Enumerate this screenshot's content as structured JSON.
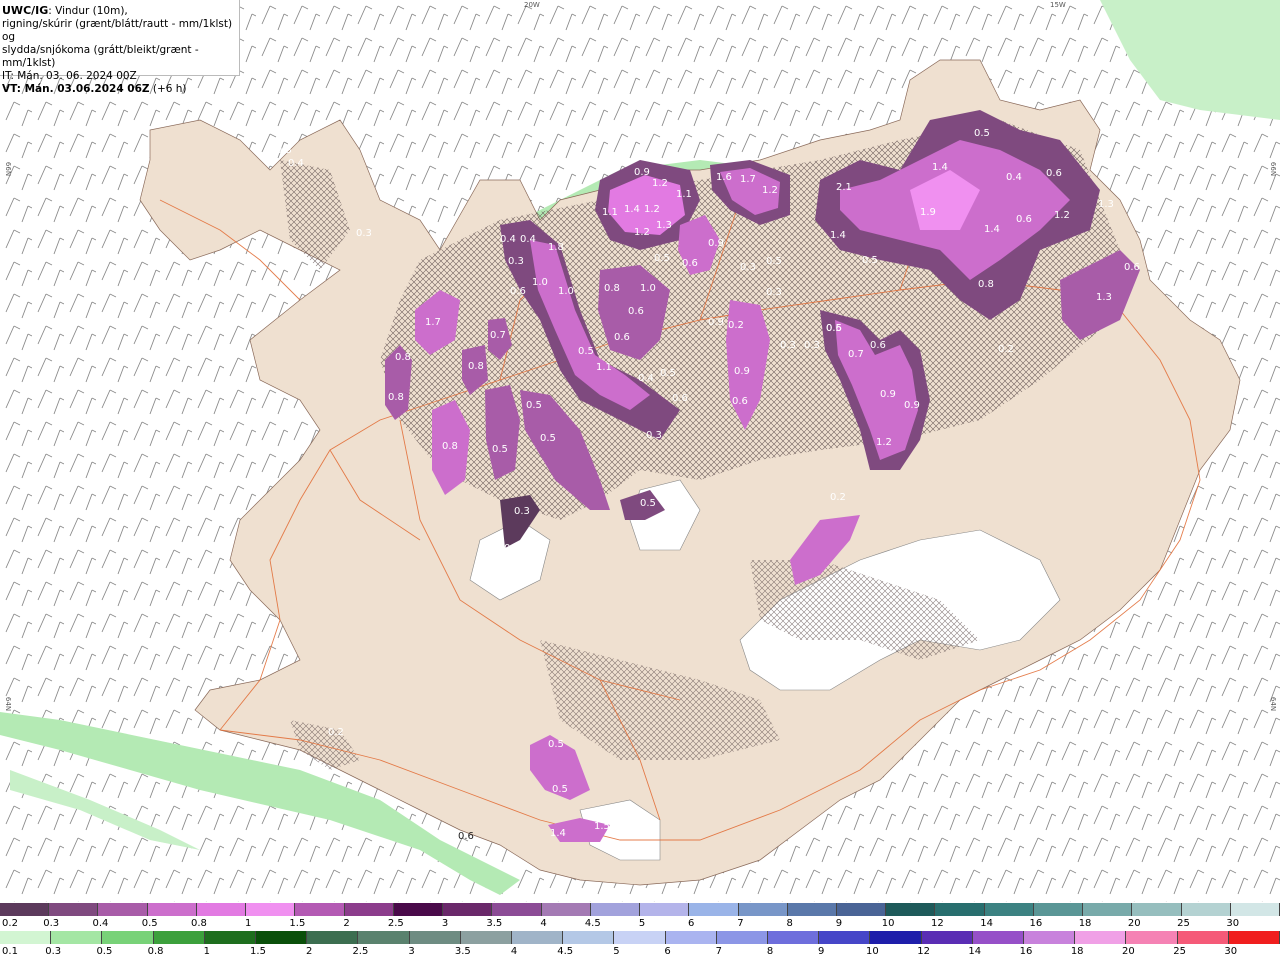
{
  "header": {
    "title_bold": "UWC/IG",
    "title_rest": ": Vindur (10m),",
    "line2": "rigning/skúrir (grænt/blátt/rautt - mm/1klst) og",
    "line3": "slydda/snjókoma (grátt/bleikt/grænt - mm/1klst)",
    "it": "IT: Mán. 03. 06. 2024 00Z",
    "vt_bold": "VT: Mán. 03.06.2024 06Z",
    "vt_rest": " (+6 h)"
  },
  "graticule": {
    "lon_20w": "20W",
    "lon_15w": "15W",
    "lat_66n_left": "66N",
    "lat_66n_right": "66N",
    "lat_64n_left": "64N",
    "lat_64n_right": "64N"
  },
  "map_values": [
    "0.3",
    "0.4",
    "0.3",
    "0.4",
    "0.4",
    "0.3",
    "0.6",
    "1.0",
    "1.8",
    "1.0",
    "1.7",
    "0.8",
    "0.9",
    "1.2",
    "1.1",
    "1.1",
    "1.4",
    "1.2",
    "1.3",
    "1.2",
    "0.5",
    "0.6",
    "0.9",
    "1.6",
    "1.7",
    "1.2",
    "0.3",
    "0.5",
    "0.3",
    "2.1",
    "1.4",
    "1.9",
    "1.4",
    "0.6",
    "1.2",
    "1.4",
    "0.5",
    "0.4",
    "0.6",
    "1.3",
    "0.6",
    "0.8",
    "0.2",
    "1.3",
    "0.5",
    "0.8",
    "0.6",
    "1.0",
    "0.7",
    "0.9",
    "0.3",
    "0.6",
    "0.8",
    "0.9",
    "0.5",
    "0.6",
    "0.2",
    "1.1",
    "0.4",
    "0.5",
    "0.5",
    "0.5",
    "0.5",
    "0.6",
    "0.3",
    "0.7",
    "0.8",
    "0.6",
    "0.9",
    "0.6",
    "0.9",
    "0.3",
    "1.2",
    "0.5",
    "0.8",
    "0.5",
    "0.3",
    "0.3",
    "0.2",
    "0.5",
    "0.2",
    "0.5",
    "0.6",
    "1.4",
    "1.5"
  ],
  "legend_snow": {
    "labels": [
      "0.2",
      "0.3",
      "0.4",
      "0.5",
      "0.8",
      "1",
      "1.5",
      "2",
      "2.5",
      "3",
      "3.5",
      "4",
      "4.5",
      "5",
      "6",
      "7",
      "8",
      "9",
      "10",
      "12",
      "14",
      "16",
      "18",
      "20",
      "25",
      "30"
    ],
    "colors": [
      "#5c3a5c",
      "#7f4a7f",
      "#a85ca8",
      "#cc6ecc",
      "#e27ae2",
      "#f090f0",
      "#b45ab4",
      "#8c3c8c",
      "#4a0a4a",
      "#6a286a",
      "#8c4c96",
      "#a47ab4",
      "#a2a2dc",
      "#b4b4ea",
      "#9ab4e8",
      "#7896c8",
      "#5a78aa",
      "#4a6496",
      "#1e5a5a",
      "#286e6e",
      "#3c8282",
      "#5a9696",
      "#78aaaa",
      "#96bebe",
      "#b4d2d2",
      "#d2e6e6"
    ]
  },
  "legend_rain": {
    "labels": [
      "0.1",
      "0.3",
      "0.5",
      "0.8",
      "1",
      "1.5",
      "2",
      "2.5",
      "3",
      "3.5",
      "4",
      "4.5",
      "5",
      "6",
      "7",
      "8",
      "9",
      "10",
      "12",
      "14",
      "16",
      "18",
      "20",
      "25",
      "30"
    ],
    "colors": [
      "#d2f5d2",
      "#a4e6a4",
      "#78d278",
      "#3ca03c",
      "#1e6e1e",
      "#0a500a",
      "#3c6e50",
      "#5a826e",
      "#6e8c82",
      "#8ca0a0",
      "#a0b4c8",
      "#b4c8e6",
      "#c8d2f5",
      "#aab4f0",
      "#8c96e6",
      "#6e6edc",
      "#4646c8",
      "#1e1eaa",
      "#5a2db4",
      "#9650c8",
      "#c882dc",
      "#f0a0e6",
      "#f582b4",
      "#f55a78",
      "#f01e1e"
    ]
  }
}
